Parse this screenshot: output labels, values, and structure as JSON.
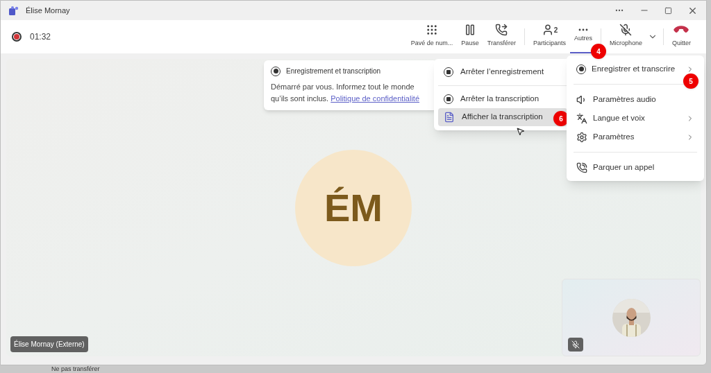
{
  "window": {
    "title": "Élise Mornay"
  },
  "toolbar": {
    "timer": "01:32",
    "recording": true,
    "buttons": [
      {
        "kind": "dialpad",
        "label": "Pavé de num...",
        "selected": false
      },
      {
        "kind": "pause",
        "label": "Pause",
        "selected": false
      },
      {
        "kind": "transfer",
        "label": "Transférer",
        "selected": false
      },
      {
        "kind": "divider"
      },
      {
        "kind": "participants",
        "label": "Participants",
        "count": "2",
        "selected": false
      },
      {
        "kind": "more",
        "label": "Autres",
        "selected": true,
        "step": "4"
      },
      {
        "kind": "divider"
      },
      {
        "kind": "mic",
        "label": "Microphone",
        "muted": true,
        "selected": false
      },
      {
        "kind": "caret"
      },
      {
        "kind": "divider"
      },
      {
        "kind": "hangup",
        "label": "Quitter",
        "selected": false
      }
    ]
  },
  "banner": {
    "title": "Enregistrement et transcription",
    "message": "Démarré par vous. Informez tout le monde qu’ils sont inclus.",
    "link": "Politique de confidentialité"
  },
  "submenu": {
    "items": [
      {
        "kind": "stop",
        "label": "Arrêter l’enregistrement",
        "selected": false
      },
      {
        "kind": "separator"
      },
      {
        "kind": "stop",
        "label": "Arrêter la transcription",
        "selected": false
      },
      {
        "kind": "transcript",
        "label": "Afficher la transcription",
        "selected": true,
        "step": "6"
      }
    ]
  },
  "menu": {
    "items": [
      {
        "kind": "record",
        "label": "Enregistrer et transcrire",
        "submenu": true,
        "step": "5"
      },
      {
        "kind": "separator"
      },
      {
        "kind": "audio",
        "label": "Paramètres audio",
        "submenu": false
      },
      {
        "kind": "language",
        "label": "Langue et voix",
        "submenu": true
      },
      {
        "kind": "settings",
        "label": "Paramètres",
        "submenu": true
      },
      {
        "kind": "separator"
      },
      {
        "kind": "park",
        "label": "Parquer un appel",
        "submenu": false
      }
    ]
  },
  "stage": {
    "initials": "ÉM",
    "name_tag": "Élise Mornay (Externe)"
  },
  "self_view": {
    "mic_muted": true
  },
  "behind": {
    "label": "Ne pas transférer"
  }
}
